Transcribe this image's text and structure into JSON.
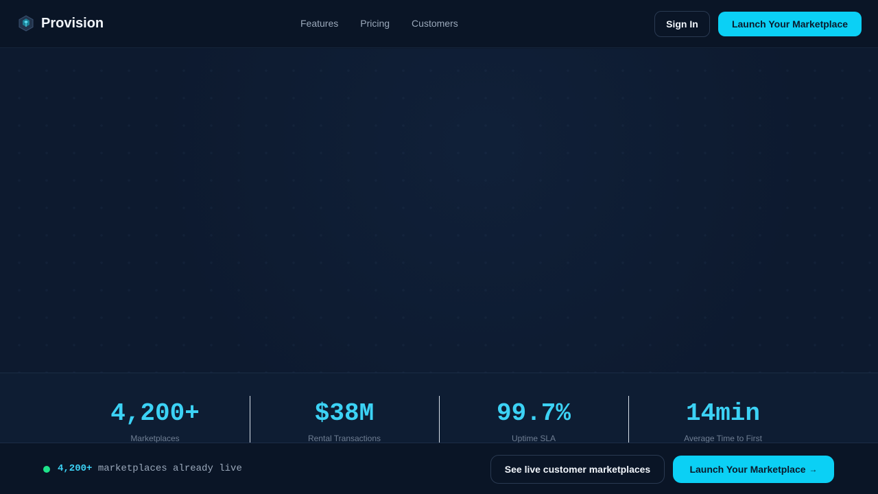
{
  "header": {
    "brand": "Provision",
    "nav": [
      "Features",
      "Pricing",
      "Customers"
    ],
    "sign_in": "Sign In",
    "cta": "Launch Your Marketplace"
  },
  "stats": [
    {
      "value": "4,200+",
      "label": "Marketplaces"
    },
    {
      "value": "$38M",
      "label": "Rental Transactions"
    },
    {
      "value": "99.7%",
      "label": "Uptime SLA"
    },
    {
      "value": "14min",
      "label": "Average Time to First"
    }
  ],
  "bottom_bar": {
    "count": "4,200+",
    "text": "marketplaces already live",
    "see_button": "See live customer marketplaces",
    "launch_button": "Launch Your Marketplace",
    "launch_arrow": "→"
  },
  "colors": {
    "accent": "#0bd0f5",
    "stat_value": "#3cd2f5",
    "live_dot": "#1ee28a",
    "background": "#0d1a2e"
  },
  "icons": {
    "brand_logo": "hexagon-cube-icon"
  }
}
